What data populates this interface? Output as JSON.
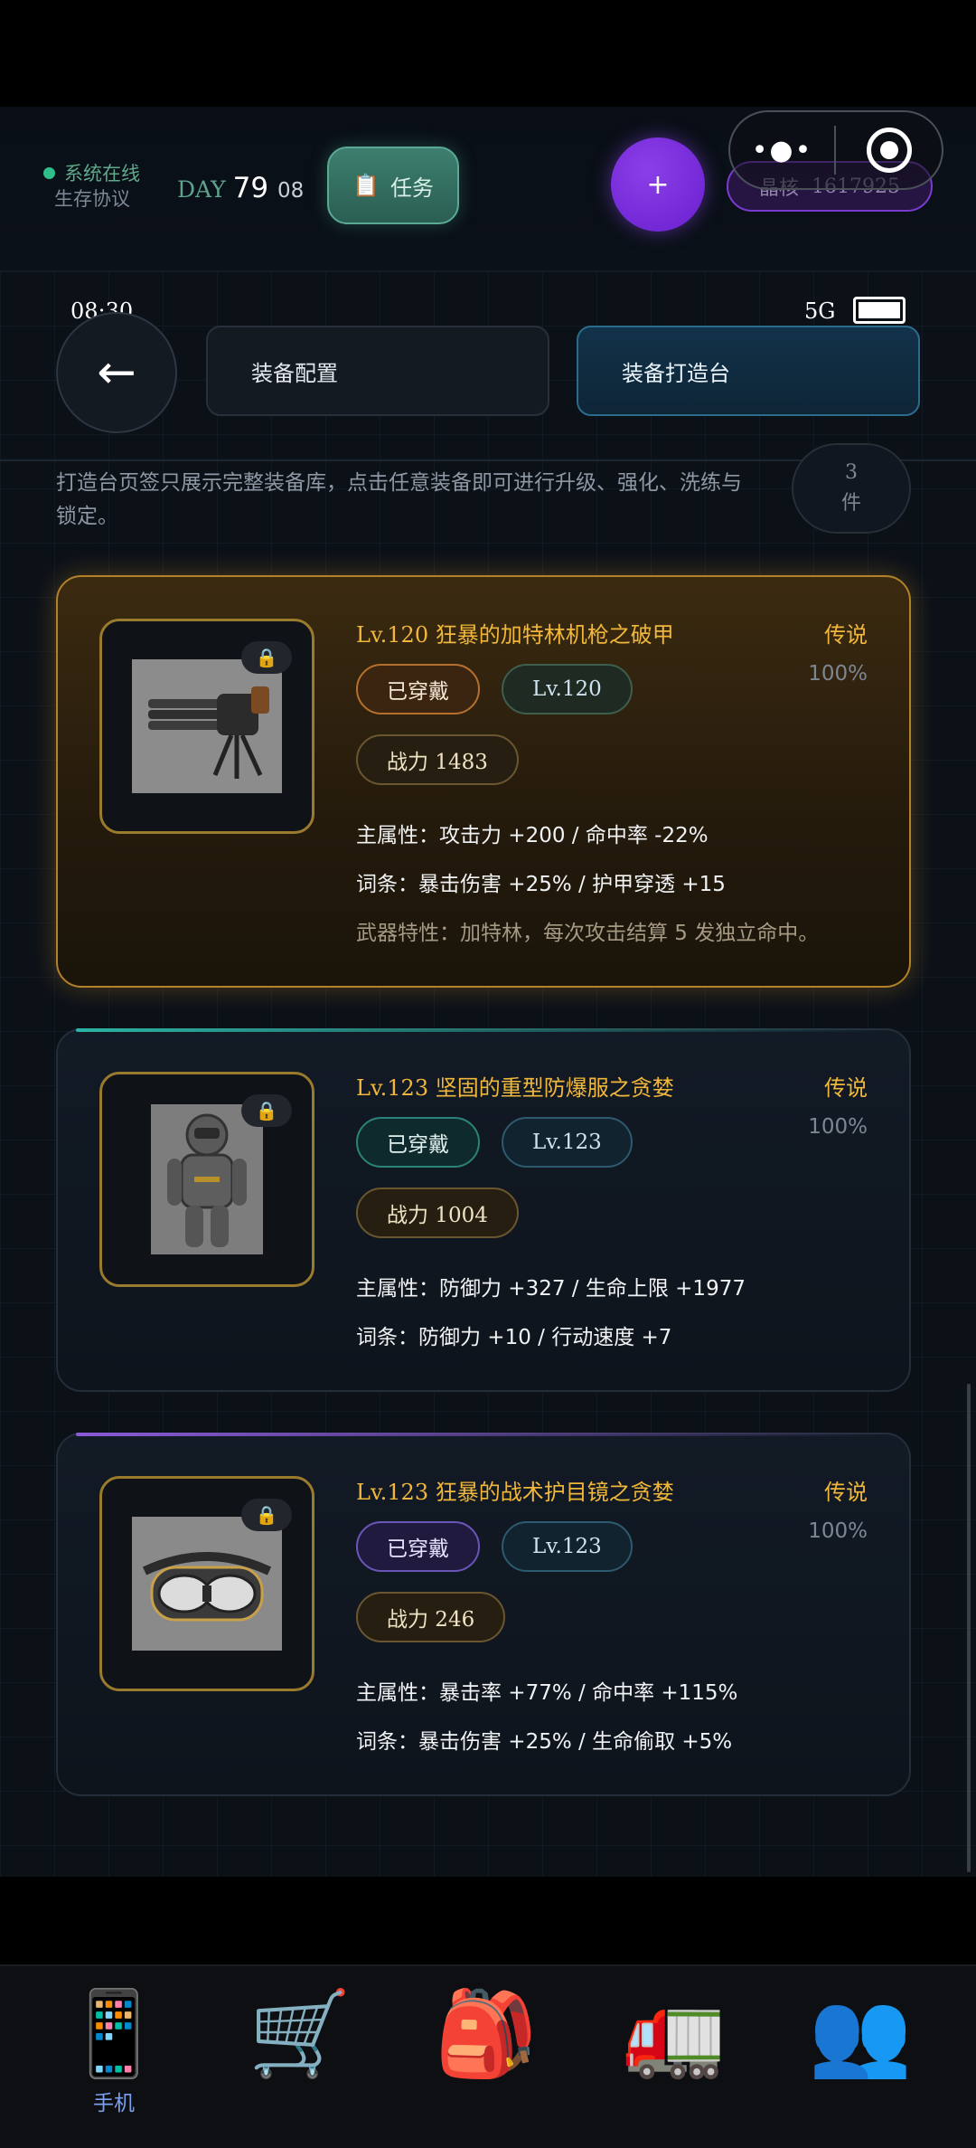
{
  "header": {
    "online_status": "系统在线",
    "protocol": "生存协议",
    "day_label": "DAY",
    "day_number": "79",
    "hour": "08",
    "task_button": "任务",
    "task_icon": "clipboard-icon",
    "plus_label": "+",
    "crystal_label": "晶核",
    "crystal_value": "1617925"
  },
  "status_bar": {
    "time": "08:30",
    "network": "5G"
  },
  "nav": {
    "back_icon": "←",
    "tab_config": "装备配置",
    "tab_forge": "装备打造台",
    "active_tab": "装备打造台"
  },
  "notice": {
    "text": "打造台页签只展示完整装备库，点击任意装备即可进行升级、强化、洗练与锁定。",
    "count_number": "3",
    "count_unit": "件"
  },
  "items": [
    {
      "title": "Lv.120 狂暴的加特林机枪之破甲",
      "rarity": "传说",
      "percent": "100%",
      "worn": "已穿戴",
      "level": "Lv.120",
      "power": "战力 1483",
      "main_attr": "主属性：攻击力 +200 / 命中率 -22%",
      "affix": "词条：暴击伤害 +25% / 护甲穿透 +15",
      "trait": "武器特性：加特林，每次攻击结算 5 发独立命中。",
      "icon": "gatling-gun-icon"
    },
    {
      "title": "Lv.123 坚固的重型防爆服之贪婪",
      "rarity": "传说",
      "percent": "100%",
      "worn": "已穿戴",
      "level": "Lv.123",
      "power": "战力 1004",
      "main_attr": "主属性：防御力 +327 / 生命上限 +1977",
      "affix": "词条：防御力 +10 / 行动速度 +7",
      "icon": "bomb-suit-icon"
    },
    {
      "title": "Lv.123 狂暴的战术护目镜之贪婪",
      "rarity": "传说",
      "percent": "100%",
      "worn": "已穿戴",
      "level": "Lv.123",
      "power": "战力 246",
      "main_attr": "主属性：暴击率 +77% / 命中率 +115%",
      "affix": "词条：暴击伤害 +25% / 生命偷取 +5%",
      "icon": "goggles-icon"
    }
  ],
  "tabbar": {
    "phone_label": "手机",
    "phone_icon": "📱",
    "cart_icon": "🛒",
    "backpack_icon": "🎒",
    "truck_icon": "🚛",
    "people_icon": "👥"
  },
  "colors": {
    "accent_gold": "#f0b73a",
    "accent_teal": "#2b8378",
    "accent_purple": "#7a3ccf"
  }
}
